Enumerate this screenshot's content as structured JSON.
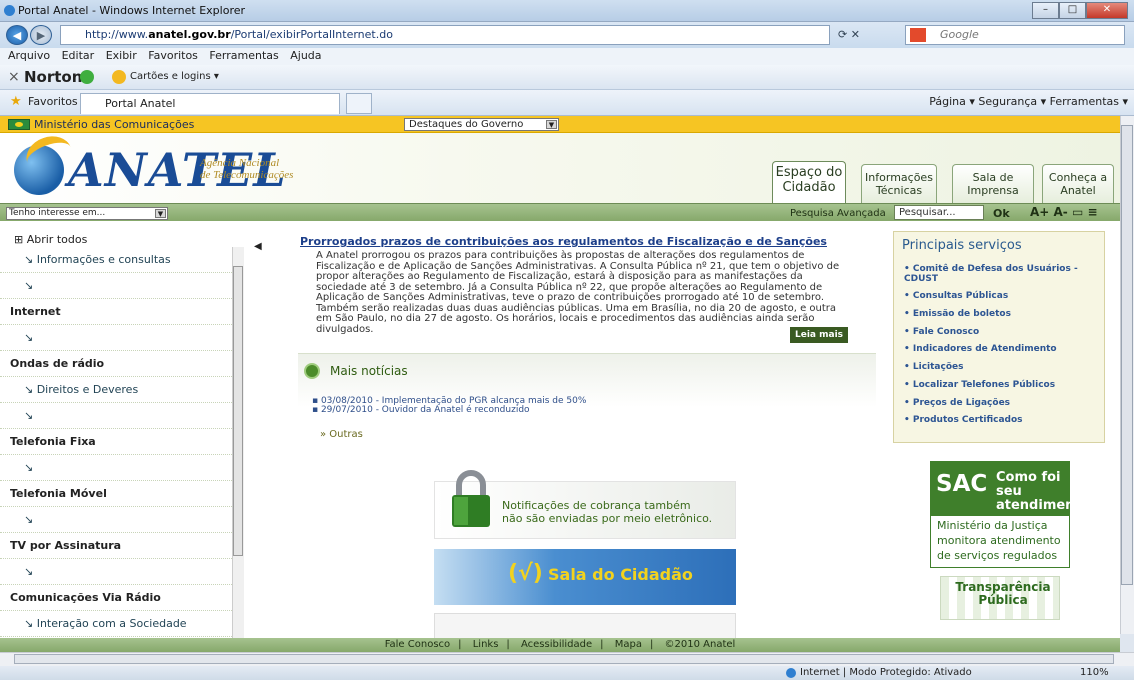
{
  "window": {
    "title": "Portal Anatel - Windows Internet Explorer"
  },
  "browser": {
    "url_prefix": "http://www.",
    "url_domain": "anatel.gov.br",
    "url_suffix": "/Portal/exibirPortalInternet.do",
    "search_placeholder": "Google",
    "menu": [
      "Arquivo",
      "Editar",
      "Exibir",
      "Favoritos",
      "Ferramentas",
      "Ajuda"
    ],
    "norton": "Norton",
    "cartoes": "Cartões e logins ▾",
    "favorites": "Favoritos",
    "tab_title": "Portal Anatel",
    "toolbar_right": "Página ▾   Segurança ▾   Ferramentas ▾"
  },
  "page": {
    "ministry": "Ministério das Comunicações",
    "destaques": "Destaques do Governo",
    "brand": "ANATEL",
    "agency_line1": "Agência Nacional",
    "agency_line2": "de Telecomunicações",
    "tabs": [
      {
        "l1": "Espaço do",
        "l2": "Cidadão"
      },
      {
        "l1": "Informações",
        "l2": "Técnicas"
      },
      {
        "l1": "Sala de",
        "l2": "Imprensa"
      },
      {
        "l1": "Conheça a",
        "l2": "Anatel"
      }
    ],
    "interesse": "Tenho interesse em...",
    "pesquisa_avancada": "Pesquisa Avançada",
    "pesquisar": "Pesquisar...",
    "ok": "Ok",
    "text_tools": "A+  A-  ▭  ≡",
    "abrir_todos": "⊞ Abrir todos",
    "sidebar": [
      "↘ Informações e consultas",
      "↘",
      "Internet",
      "↘",
      "Ondas de rádio",
      "↘ Direitos e Deveres",
      "↘",
      "Telefonia Fixa",
      "↘",
      "Telefonia Móvel",
      "↘",
      "TV por Assinatura",
      "↘",
      "Comunicações Via Rádio",
      "↘ Interação com a Sociedade"
    ],
    "headline": "Prorrogados prazos de contribuições aos regulamentos de Fiscalização e de Sanções",
    "body": "A Anatel prorrogou os prazos para contribuições às propostas de alterações dos regulamentos de Fiscalização e de Aplicação de Sanções Administrativas. A Consulta Pública nº 21, que tem o objetivo de propor alterações ao Regulamento de Fiscalização, estará à disposição para as manifestações da sociedade até 3 de setembro. Já a Consulta Pública nº 22, que propõe alterações ao Regulamento de Aplicação de Sanções Administrativas, teve o prazo de contribuições prorrogado até 10 de setembro. Também serão realizadas duas duas audiências públicas. Uma em Brasília, no dia 20 de agosto, e outra em São Paulo, no dia 27 de agosto. Os horários, locais e procedimentos das audiências ainda serão divulgados.",
    "leia_mais": "Leia mais",
    "mais_noticias": "Mais notícias",
    "news": [
      "▪ 03/08/2010 - Implementação do PGR alcança mais de 50%",
      "▪ 29/07/2010 - Ouvidor da Anatel é reconduzido"
    ],
    "outras": "» Outras",
    "banner1_l1": "Notificações de cobrança também",
    "banner1_l2": "não são enviadas por meio eletrônico.",
    "banner2": "Sala do Cidadão",
    "servicos_title": "Principais serviços",
    "servicos": [
      "Comitê de Defesa dos Usuários - CDUST",
      "Consultas Públicas",
      "Emissão de boletos",
      "Fale Conosco",
      "Indicadores de Atendimento",
      "Licitações",
      "Localizar Telefones Públicos",
      "Preços de Ligações",
      "Produtos Certificados"
    ],
    "sac_big": "SAC",
    "sac_l1": "Como foi seu",
    "sac_l2": "atendimento",
    "sac_text": "Ministério da Justiça monitora atendimento de serviços regulados",
    "transp_l1": "Transparência",
    "transp_l2": "Pública",
    "footer": [
      "Fale Conosco",
      "Links",
      "Acessibilidade",
      "Mapa",
      "©2010 Anatel"
    ]
  },
  "status": {
    "zone": "Internet | Modo Protegido: Ativado",
    "zoom": "110%"
  }
}
